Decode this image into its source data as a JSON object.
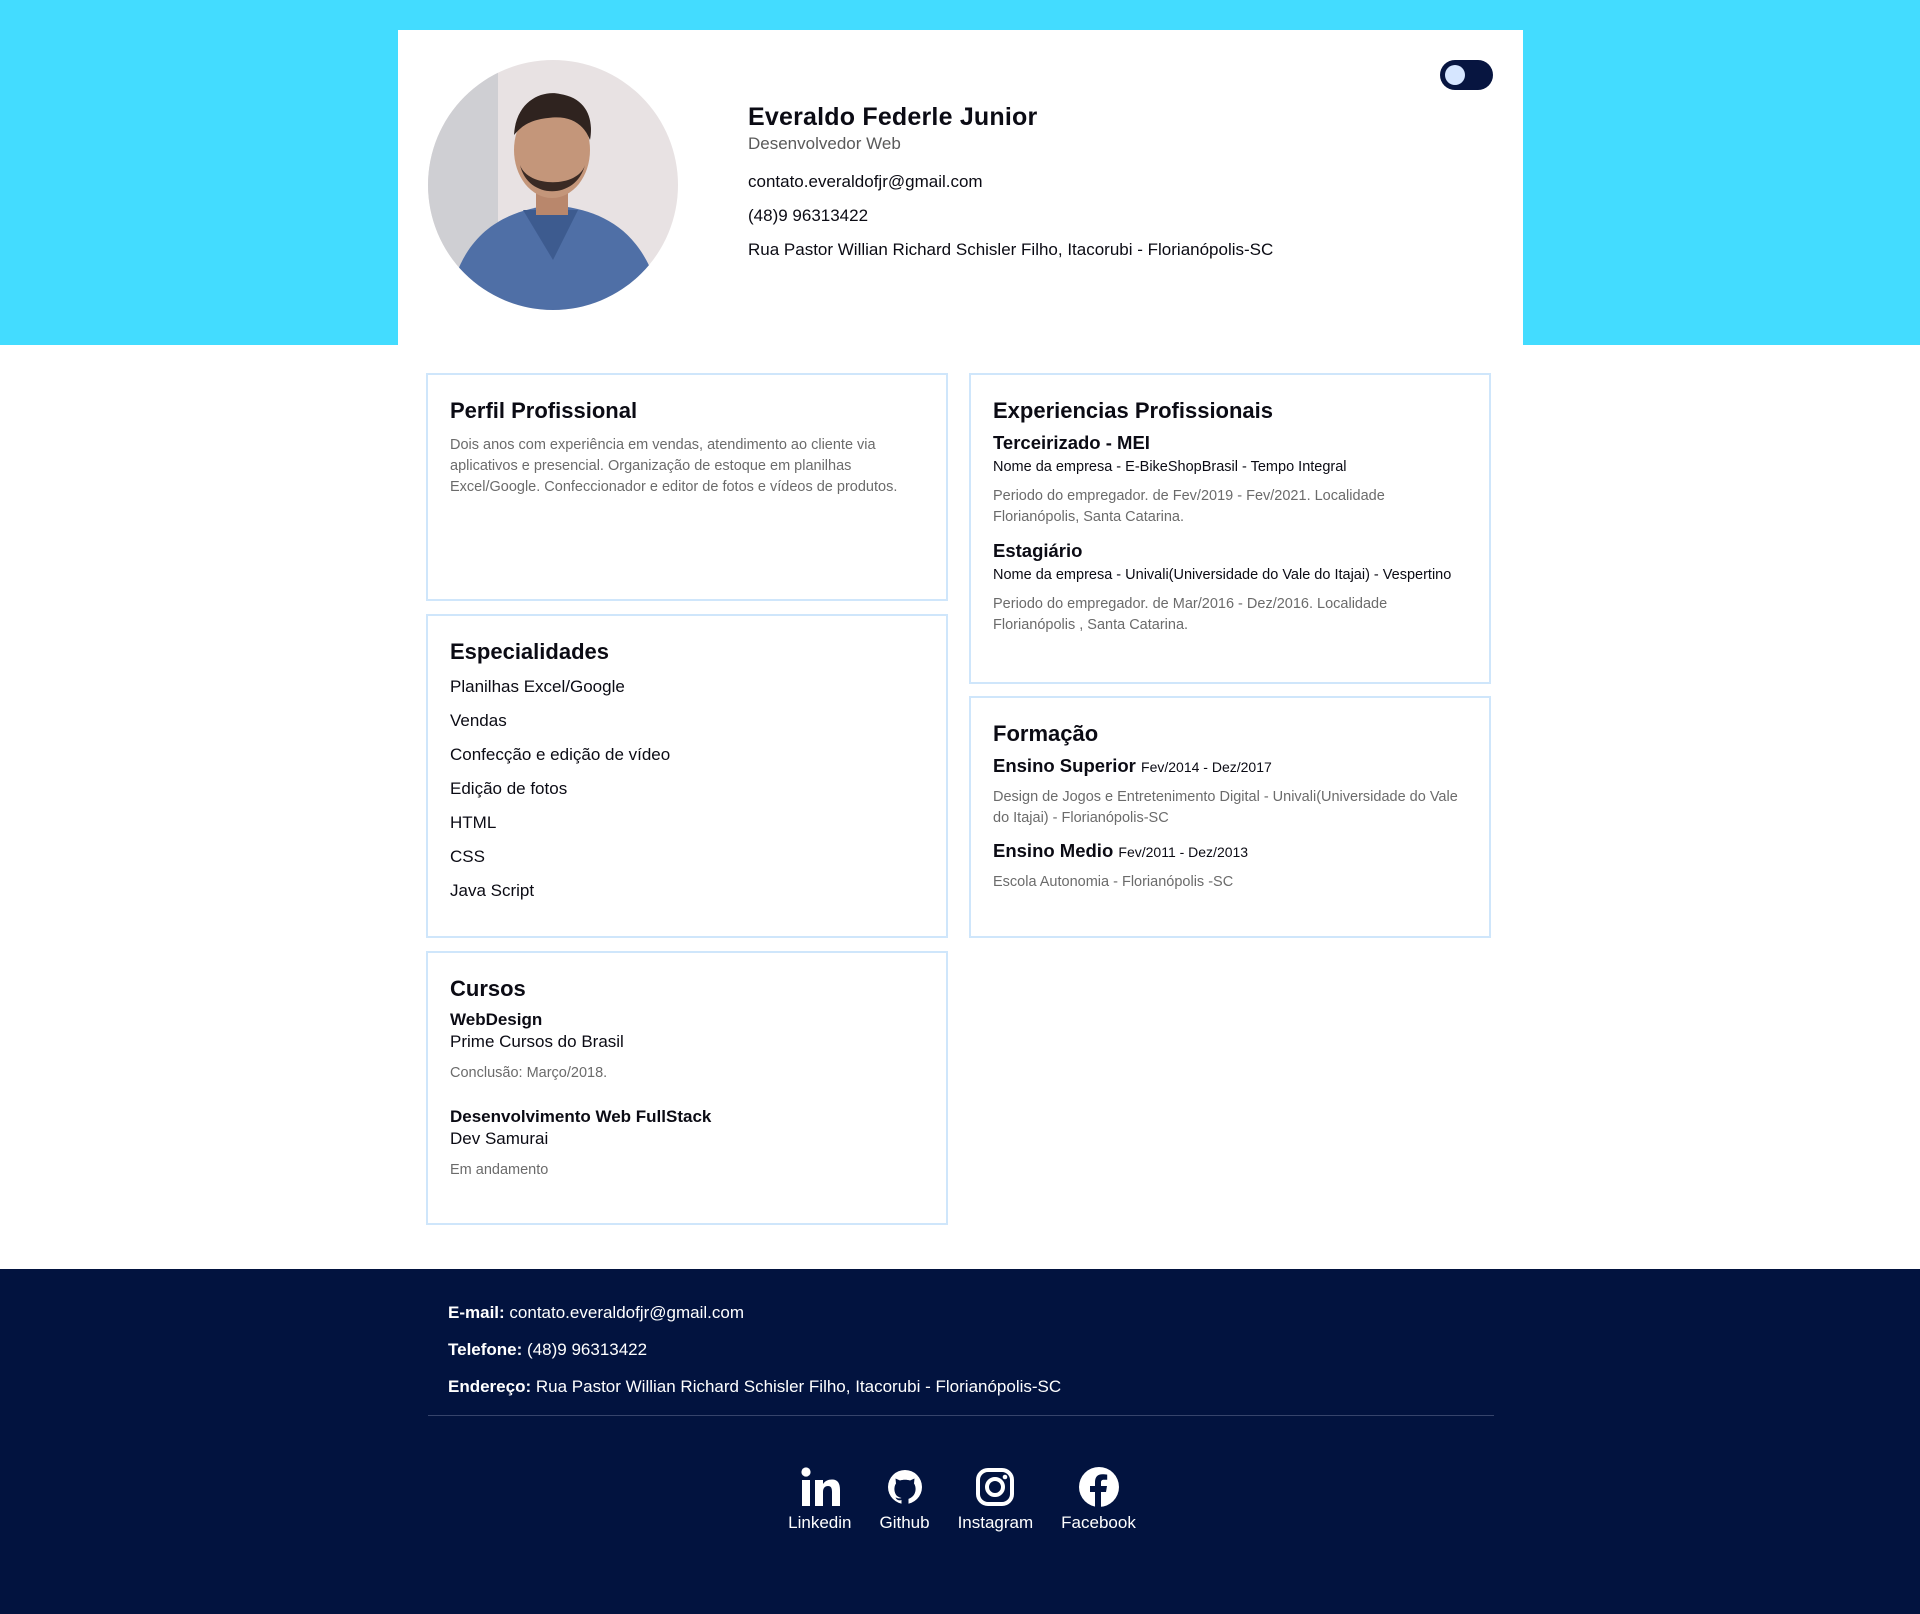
{
  "colors": {
    "header_band": "#43dcff",
    "footer_bg": "#02133f",
    "card_border": "#cfe6fb",
    "toggle": "#071540"
  },
  "profile": {
    "name": "Everaldo Federle Junior",
    "role": "Desenvolvedor Web",
    "email": "contato.everaldofjr@gmail.com",
    "phone": "(48)9 96313422",
    "address": "Rua Pastor Willian Richard Schisler Filho, Itacorubi - Florianópolis-SC",
    "photo_icon": "profile-photo"
  },
  "theme_toggle": {
    "icon": "toggle-switch-icon"
  },
  "perfil": {
    "title": "Perfil Profissional",
    "text": "Dois anos com experiência em vendas, atendimento ao cliente via aplicativos e presencial. Organização de estoque em planilhas Excel/Google. Confeccionador e editor de fotos e vídeos de produtos."
  },
  "especialidades": {
    "title": "Especialidades",
    "items": [
      "Planilhas Excel/Google",
      "Vendas",
      "Confecção e edição de vídeo",
      "Edição de fotos",
      "HTML",
      "CSS",
      "Java Script"
    ]
  },
  "cursos": {
    "title": "Cursos",
    "items": [
      {
        "name": "WebDesign",
        "school": "Prime Cursos do Brasil",
        "status": "Conclusão: Março/2018."
      },
      {
        "name": "Desenvolvimento Web FullStack",
        "school": "Dev Samurai",
        "status": "Em andamento"
      }
    ]
  },
  "experiencias": {
    "title": "Experiencias Profissionais",
    "items": [
      {
        "role": "Terceirizado - MEI",
        "company": "Nome da empresa - E-BikeShopBrasil - Tempo Integral",
        "period": "Periodo do empregador. de Fev/2019 - Fev/2021. Localidade Florianópolis, Santa Catarina."
      },
      {
        "role": "Estagiário",
        "company": "Nome da empresa - Univali(Universidade do Vale do Itajai) - Vespertino",
        "period": "Periodo do empregador. de Mar/2016 - Dez/2016. Localidade Florianópolis , Santa Catarina."
      }
    ]
  },
  "formacao": {
    "title": "Formação",
    "items": [
      {
        "level": "Ensino Superior",
        "dates": "Fev/2014 - Dez/2017",
        "desc": "Design de Jogos e Entretenimento Digital - Univali(Universidade do Vale do Itajai) - Florianópolis-SC"
      },
      {
        "level": "Ensino Medio",
        "dates": "Fev/2011 - Dez/2013",
        "desc": "Escola Autonomia - Florianópolis -SC"
      }
    ]
  },
  "footer": {
    "email_label": "E-mail:",
    "email": "contato.everaldofjr@gmail.com",
    "phone_label": "Telefone:",
    "phone": "(48)9 96313422",
    "address_label": "Endereço:",
    "address": "Rua Pastor Willian Richard Schisler Filho, Itacorubi - Florianópolis-SC",
    "socials": [
      {
        "label": "Linkedin",
        "icon": "linkedin-icon"
      },
      {
        "label": "Github",
        "icon": "github-icon"
      },
      {
        "label": "Instagram",
        "icon": "instagram-icon"
      },
      {
        "label": "Facebook",
        "icon": "facebook-icon"
      }
    ]
  }
}
